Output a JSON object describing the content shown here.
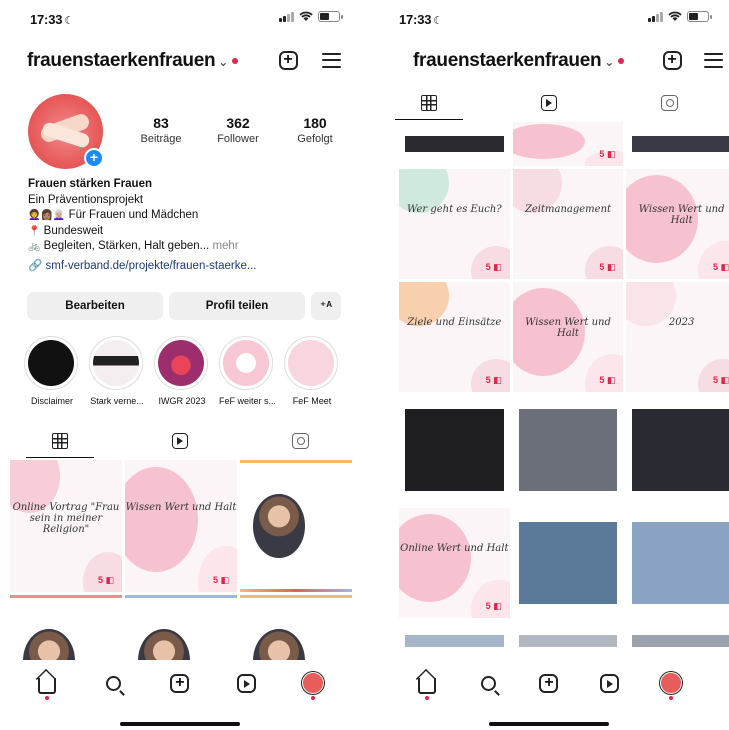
{
  "status": {
    "time": "17:33"
  },
  "header": {
    "username": "frauenstaerkenfrauen"
  },
  "profile": {
    "stats": [
      {
        "num": "83",
        "label": "Beiträge"
      },
      {
        "num": "362",
        "label": "Follower"
      },
      {
        "num": "180",
        "label": "Gefolgt"
      }
    ],
    "bio": {
      "name": "Frauen stärken Frauen",
      "line1": "Ein Präventionsprojekt",
      "line2": "Für Frauen und Mädchen",
      "line3": "Bundesweit",
      "line4": "Begleiten, Stärken, Halt geben...",
      "more": "mehr",
      "link": "smf-verband.de/projekte/frauen-staerke..."
    },
    "actions": {
      "edit": "Bearbeiten",
      "share": "Profil teilen"
    }
  },
  "highlights": [
    {
      "label": "Disclaimer",
      "color": "#111111"
    },
    {
      "label": "Stark verne...",
      "color": "#f4eef0"
    },
    {
      "label": "IWGR 2023",
      "color": "#9c2e6e"
    },
    {
      "label": "FeF weiter s...",
      "color": "#fbe8ee"
    },
    {
      "label": "FeF Meet",
      "color": "#f7d6e0"
    }
  ],
  "left_grid": [
    {
      "kind": "text",
      "title": "Online Vortrag \"Frau sein in meiner Religion\"",
      "accent": "#f6c6d2"
    },
    {
      "kind": "pink",
      "title": "Wissen Wert und Halt",
      "accent": "#f4b8c8"
    },
    {
      "kind": "portrait",
      "title": "",
      "accent": "#f3b86a"
    },
    {
      "kind": "portrait",
      "title": "",
      "accent": "#f28b8b"
    },
    {
      "kind": "portrait",
      "title": "",
      "accent": "#9fb7e6"
    },
    {
      "kind": "portrait",
      "title": "",
      "accent": "#f3b86a"
    }
  ],
  "right_grid": [
    {
      "kind": "photo",
      "title": "",
      "accent": "#2a2a30"
    },
    {
      "kind": "pink",
      "title": "",
      "accent": "#f4b8c8"
    },
    {
      "kind": "photo",
      "title": "",
      "accent": "#3a3a44"
    },
    {
      "kind": "text",
      "title": "Wer geht es Euch?",
      "accent": "#c8e6d8"
    },
    {
      "kind": "text",
      "title": "Zeitmanagement",
      "accent": "#f6d7df"
    },
    {
      "kind": "pink",
      "title": "Wissen Wert und Halt",
      "accent": "#f4b8c8"
    },
    {
      "kind": "text",
      "title": "Ziele und Einsätze",
      "accent": "#f8c9a0"
    },
    {
      "kind": "pink",
      "title": "Wissen Wert und Halt",
      "accent": "#f4b8c8"
    },
    {
      "kind": "text",
      "title": "2023",
      "accent": "#f8e0e6"
    },
    {
      "kind": "photo",
      "title": "",
      "accent": "#1e1e22"
    },
    {
      "kind": "photo",
      "title": "",
      "accent": "#6a6f7a"
    },
    {
      "kind": "photo",
      "title": "",
      "accent": "#2a2a33"
    },
    {
      "kind": "pink",
      "title": "Online Wert und Halt",
      "accent": "#f4b8c8"
    },
    {
      "kind": "photo",
      "title": "",
      "accent": "#5b7a9a"
    },
    {
      "kind": "photo",
      "title": "",
      "accent": "#8aa3c2"
    },
    {
      "kind": "photo",
      "title": "",
      "accent": "#a7b5c8"
    },
    {
      "kind": "photo",
      "title": "",
      "accent": "#b0b7c1"
    },
    {
      "kind": "photo",
      "title": "",
      "accent": "#9aa2ae"
    }
  ],
  "colors": {
    "accent_red": "#e0244b",
    "link_blue": "#1a3a7a",
    "button_bg": "#efefef"
  },
  "icons": {
    "tabs": [
      "grid-icon",
      "reels-icon",
      "tagged-icon"
    ],
    "nav": [
      "home-icon",
      "search-icon",
      "add-icon",
      "reels-icon",
      "profile-icon"
    ]
  }
}
